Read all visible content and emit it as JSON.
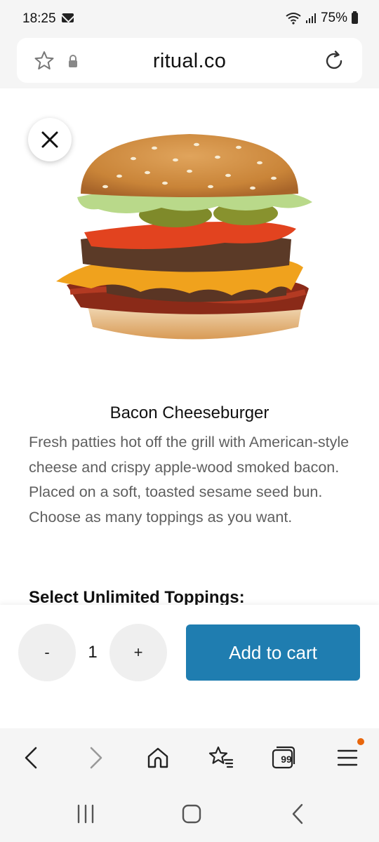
{
  "status_bar": {
    "time": "18:25",
    "battery": "75%"
  },
  "address_bar": {
    "url": "ritual.co"
  },
  "product": {
    "image_icon": "cheeseburger-photo",
    "title": "Bacon Cheeseburger",
    "description": "Fresh patties hot off the grill with American-style cheese and crispy apple-wood smoked bacon. Placed on a soft, toasted sesame seed bun. Choose as many toppings as you want.",
    "toppings_heading": "Select Unlimited Toppings:"
  },
  "cart": {
    "minus_label": "-",
    "quantity": "1",
    "plus_label": "+",
    "add_label": "Add to cart"
  },
  "browser_nav": {
    "tabs_count": "99"
  },
  "colors": {
    "accent": "#1f7db0",
    "notification": "#e8660c"
  }
}
